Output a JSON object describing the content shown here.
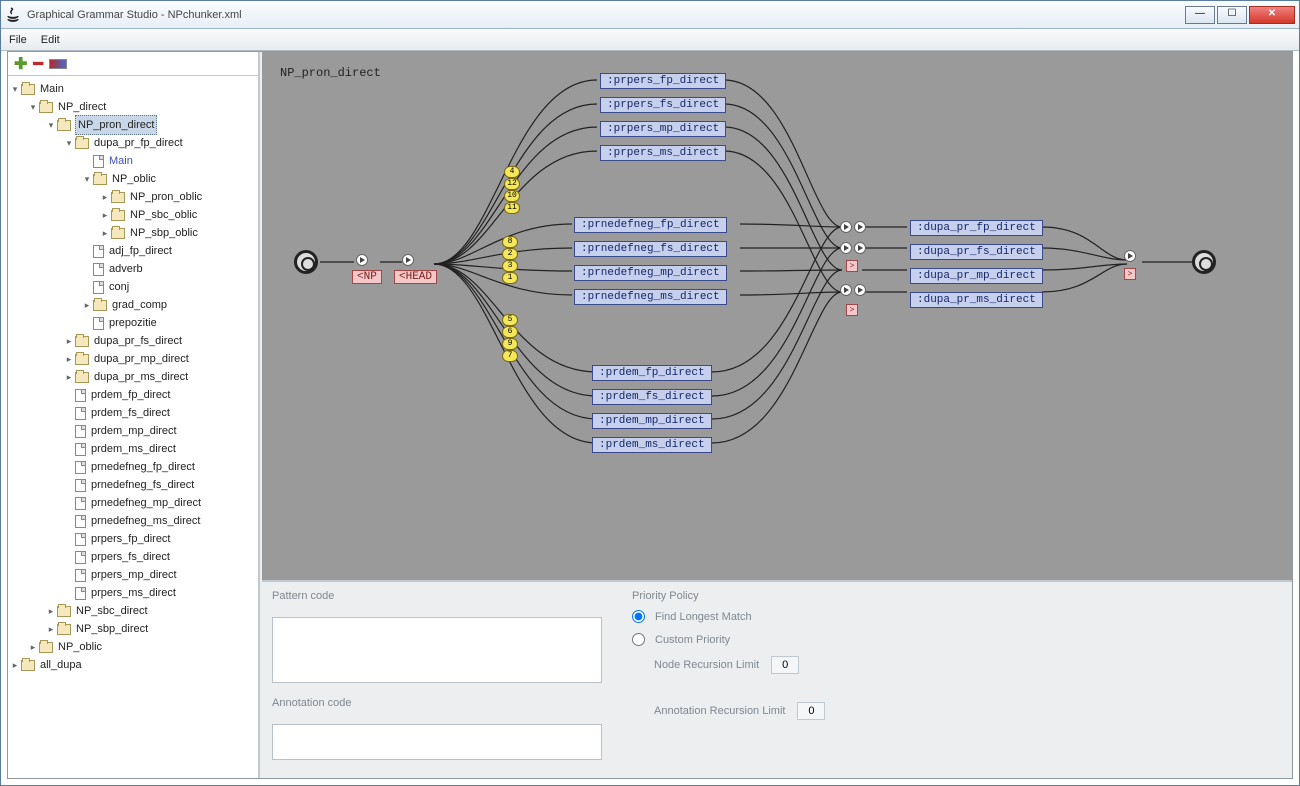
{
  "window": {
    "title": "Graphical Grammar Studio - NPchunker.xml"
  },
  "menubar": {
    "file": "File",
    "edit": "Edit"
  },
  "tree": [
    {
      "d": 0,
      "t": "f",
      "tw": "▾",
      "l": "Main"
    },
    {
      "d": 1,
      "t": "f",
      "tw": "▾",
      "l": "NP_direct"
    },
    {
      "d": 2,
      "t": "f",
      "tw": "▾",
      "l": "NP_pron_direct",
      "sel": true
    },
    {
      "d": 3,
      "t": "f",
      "tw": "▾",
      "l": "dupa_pr_fp_direct"
    },
    {
      "d": 4,
      "t": "p",
      "tw": "",
      "l": "Main",
      "link": true
    },
    {
      "d": 4,
      "t": "f",
      "tw": "▾",
      "l": "NP_oblic"
    },
    {
      "d": 5,
      "t": "f",
      "tw": "▸",
      "l": "NP_pron_oblic"
    },
    {
      "d": 5,
      "t": "f",
      "tw": "▸",
      "l": "NP_sbc_oblic"
    },
    {
      "d": 5,
      "t": "f",
      "tw": "▸",
      "l": "NP_sbp_oblic"
    },
    {
      "d": 4,
      "t": "p",
      "tw": "",
      "l": "adj_fp_direct"
    },
    {
      "d": 4,
      "t": "p",
      "tw": "",
      "l": "adverb"
    },
    {
      "d": 4,
      "t": "p",
      "tw": "",
      "l": "conj"
    },
    {
      "d": 4,
      "t": "f",
      "tw": "▸",
      "l": "grad_comp"
    },
    {
      "d": 4,
      "t": "p",
      "tw": "",
      "l": "prepozitie"
    },
    {
      "d": 3,
      "t": "f",
      "tw": "▸",
      "l": "dupa_pr_fs_direct"
    },
    {
      "d": 3,
      "t": "f",
      "tw": "▸",
      "l": "dupa_pr_mp_direct"
    },
    {
      "d": 3,
      "t": "f",
      "tw": "▸",
      "l": "dupa_pr_ms_direct"
    },
    {
      "d": 3,
      "t": "p",
      "tw": "",
      "l": "prdem_fp_direct"
    },
    {
      "d": 3,
      "t": "p",
      "tw": "",
      "l": "prdem_fs_direct"
    },
    {
      "d": 3,
      "t": "p",
      "tw": "",
      "l": "prdem_mp_direct"
    },
    {
      "d": 3,
      "t": "p",
      "tw": "",
      "l": "prdem_ms_direct"
    },
    {
      "d": 3,
      "t": "p",
      "tw": "",
      "l": "prnedefneg_fp_direct"
    },
    {
      "d": 3,
      "t": "p",
      "tw": "",
      "l": "prnedefneg_fs_direct"
    },
    {
      "d": 3,
      "t": "p",
      "tw": "",
      "l": "prnedefneg_mp_direct"
    },
    {
      "d": 3,
      "t": "p",
      "tw": "",
      "l": "prnedefneg_ms_direct"
    },
    {
      "d": 3,
      "t": "p",
      "tw": "",
      "l": "prpers_fp_direct"
    },
    {
      "d": 3,
      "t": "p",
      "tw": "",
      "l": "prpers_fs_direct"
    },
    {
      "d": 3,
      "t": "p",
      "tw": "",
      "l": "prpers_mp_direct"
    },
    {
      "d": 3,
      "t": "p",
      "tw": "",
      "l": "prpers_ms_direct"
    },
    {
      "d": 2,
      "t": "f",
      "tw": "▸",
      "l": "NP_sbc_direct"
    },
    {
      "d": 2,
      "t": "f",
      "tw": "▸",
      "l": "NP_sbp_direct"
    },
    {
      "d": 1,
      "t": "f",
      "tw": "▸",
      "l": "NP_oblic"
    },
    {
      "d": 0,
      "t": "f",
      "tw": "▸",
      "l": "all_dupa"
    }
  ],
  "graph": {
    "title": "NP_pron_direct",
    "pink": {
      "np": "<NP",
      "head": "<HEAD"
    },
    "col1": [
      ":prpers_fp_direct",
      ":prpers_fs_direct",
      ":prpers_mp_direct",
      ":prpers_ms_direct"
    ],
    "col2": [
      ":prnedefneg_fp_direct",
      ":prnedefneg_fs_direct",
      ":prnedefneg_mp_direct",
      ":prnedefneg_ms_direct"
    ],
    "col3": [
      ":prdem_fp_direct",
      ":prdem_fs_direct",
      ":prdem_mp_direct",
      ":prdem_ms_direct"
    ],
    "col4": [
      ":dupa_pr_fp_direct",
      ":dupa_pr_fs_direct",
      ":dupa_pr_mp_direct",
      ":dupa_pr_ms_direct"
    ],
    "bubbles_a": [
      "4",
      "12",
      "10",
      "11"
    ],
    "bubbles_b": [
      "8",
      "2",
      "3",
      "1"
    ],
    "bubbles_c": [
      "5",
      "6",
      "9",
      "7"
    ]
  },
  "panel": {
    "pattern_label": "Pattern code",
    "annotation_label": "Annotation code",
    "priority_label": "Priority Policy",
    "longest": "Find Longest Match",
    "custom": "Custom Priority",
    "nrl": "Node Recursion Limit",
    "arl": "Annotation Recursion Limit",
    "nrl_val": "0",
    "arl_val": "0"
  }
}
